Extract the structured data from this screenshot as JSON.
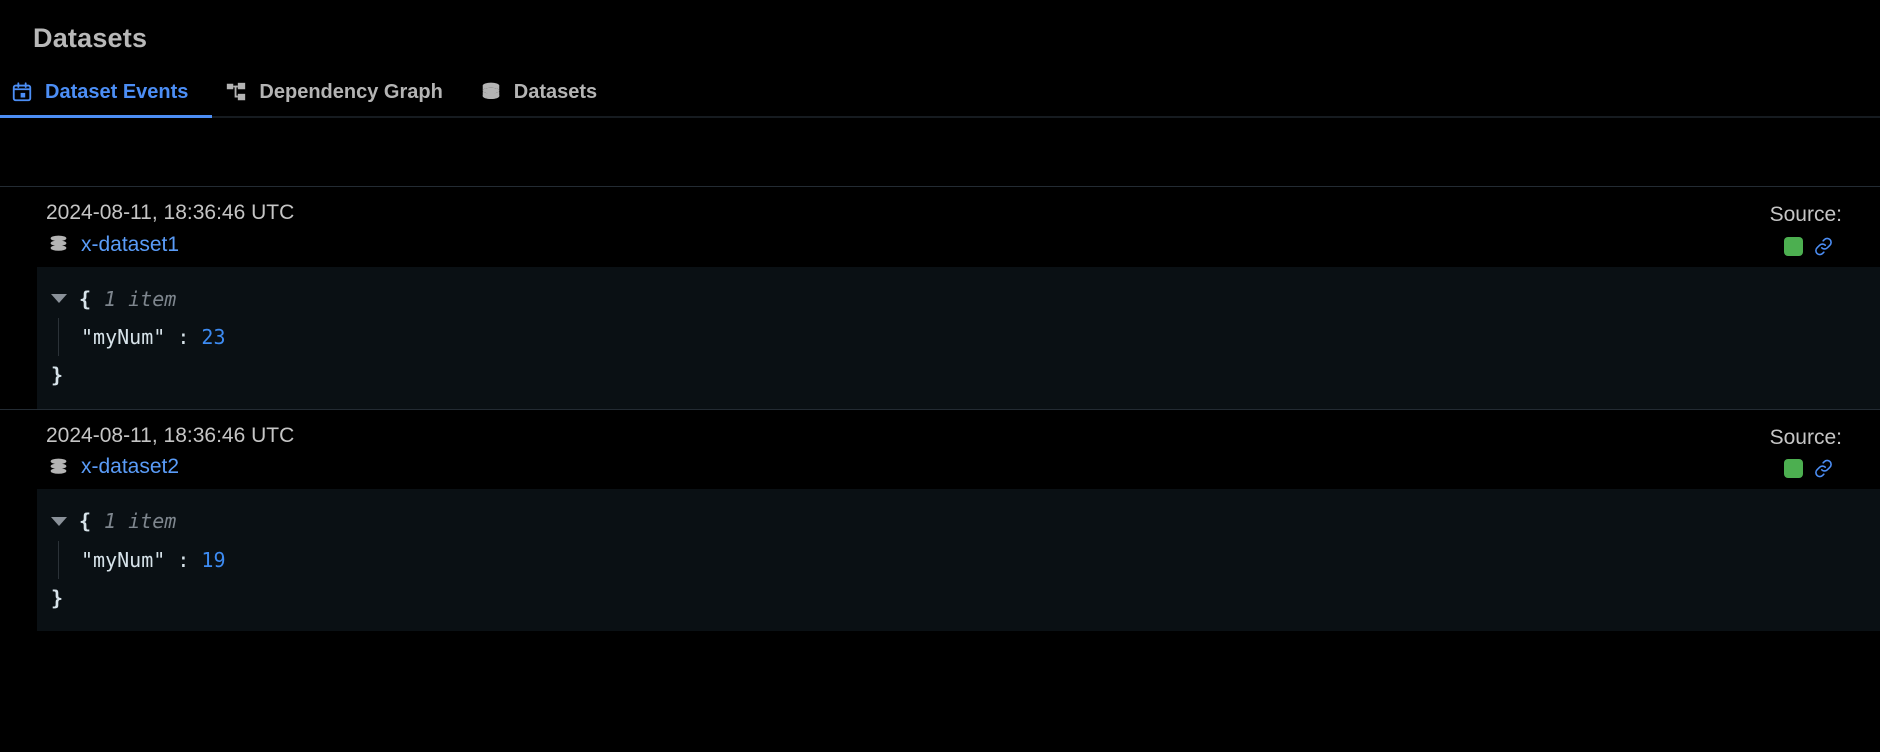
{
  "header": {
    "title": "Datasets"
  },
  "tabs": [
    {
      "label": "Dataset Events",
      "icon": "calendar-icon",
      "active": true
    },
    {
      "label": "Dependency Graph",
      "icon": "dependency-graph-icon",
      "active": false
    },
    {
      "label": "Datasets",
      "icon": "database-icon",
      "active": false
    }
  ],
  "source_label": "Source:",
  "colors": {
    "accent": "#4c8ef5",
    "link": "#5a9cf8",
    "status_green": "#4caf50",
    "json_number": "#3d8bf2",
    "panel_bg": "#0a1014"
  },
  "events": [
    {
      "timestamp": "2024-08-11, 18:36:46 UTC",
      "dataset": "x-dataset1",
      "json": {
        "brace_open": "{",
        "count": "1 item",
        "key": "\"myNum\"",
        "colon": ":",
        "value": "23",
        "brace_close": "}"
      }
    },
    {
      "timestamp": "2024-08-11, 18:36:46 UTC",
      "dataset": "x-dataset2",
      "json": {
        "brace_open": "{",
        "count": "1 item",
        "key": "\"myNum\"",
        "colon": ":",
        "value": "19",
        "brace_close": "}"
      }
    }
  ]
}
